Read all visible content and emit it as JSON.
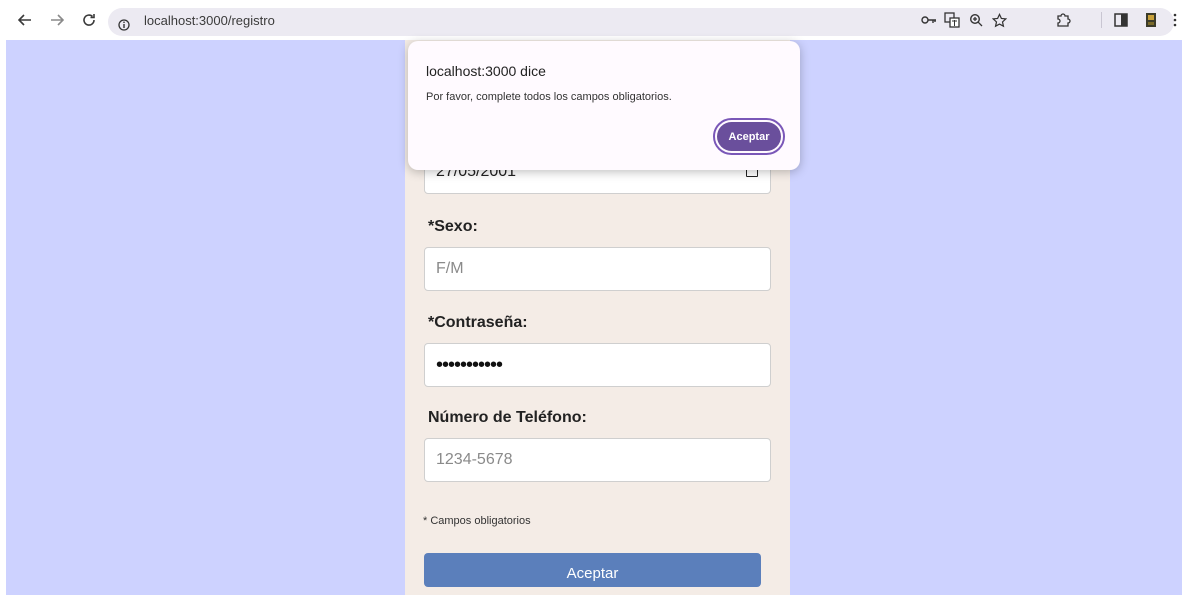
{
  "browser": {
    "url": "localhost:3000/registro"
  },
  "form": {
    "date_value": "27/05/2001",
    "sexo_label": "*Sexo:",
    "sexo_placeholder": "F/M",
    "password_label": "*Contraseña:",
    "password_dots": "•••••••••••",
    "phone_label": "Número de Teléfono:",
    "phone_placeholder": "1234-5678",
    "required_note": "* Campos obligatorios",
    "submit_label": "Aceptar"
  },
  "dialog": {
    "title": "localhost:3000 dice",
    "message": "Por favor, complete todos los campos obligatorios.",
    "ok_label": "Aceptar"
  },
  "colors": {
    "page_bg": "#cdd2ff",
    "panel_bg": "#f4ece6",
    "submit_bg": "#5b7fbb",
    "dialog_button": "#6a4f9c"
  },
  "icons": [
    "back-icon",
    "forward-icon",
    "reload-icon",
    "info-icon",
    "key-icon",
    "translate-icon",
    "zoom-icon",
    "star-icon",
    "extensions-icon",
    "side-panel-icon",
    "profile-icon",
    "menu-icon"
  ]
}
